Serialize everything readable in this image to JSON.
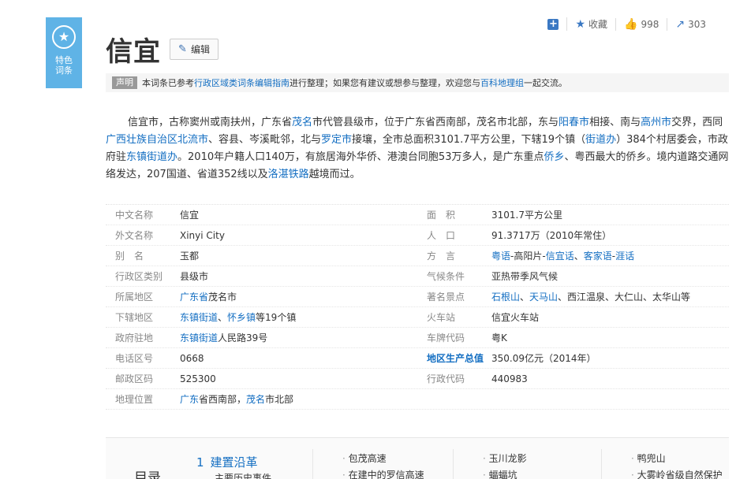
{
  "badge": {
    "line1": "特色",
    "line2": "词条"
  },
  "title": "信宜",
  "edit_label": "编辑",
  "toolbar": {
    "favorite_label": "收藏",
    "likes": "998",
    "shares": "303"
  },
  "notice": {
    "tag": "声明",
    "p1": "本词条已参考",
    "link1": "行政区域类词条编辑指南",
    "p2": "进行整理；如果您有建议或想参与整理，欢迎您与",
    "link2": "百科地理组",
    "p3": "一起交流。"
  },
  "summary": {
    "s1": "信宜市，古称窦州或南扶州，广东省",
    "l1": "茂名",
    "s2": "市代管县级市，位于广东省西南部，茂名市北部，东与",
    "l2": "阳春市",
    "s3": "相接、南与",
    "l3": "高州市",
    "s4": "交界，西同",
    "l4": "广西壮族自治区北流市",
    "s5": "、容县、岑溪毗邻，北与",
    "l5": "罗定市",
    "s6": "接壤，全市总面积3101.7平方公里，下辖19个镇（",
    "l6": "街道办",
    "s7": "）384个村居委会，市政府驻",
    "l7": "东镇街道办",
    "s8": "。2010年户籍人口140万，有旅居海外华侨、港澳台同胞53万多人，是广东重点",
    "l8": "侨乡",
    "s9": "、粤西最大的侨乡。境内道路交通网络发达，207国道、省道352线以及",
    "l9": "洛湛铁路",
    "s10": "越境而过。"
  },
  "info": {
    "r1": {
      "k1": "中文名称",
      "v1": "信宜",
      "k2": "面　积",
      "v2": "3101.7平方公里"
    },
    "r2": {
      "k1": "外文名称",
      "v1": "Xinyi City",
      "k2": "人　口",
      "v2": "91.3717万（2010年常住）"
    },
    "r3": {
      "k1": "别　名",
      "v1": "玉都",
      "k2": "方　言",
      "v2a": "粤语",
      "v2b": "-高阳片-",
      "v2c": "信宜话",
      "v2d": "、",
      "v2e": "客家语",
      "v2f": "-",
      "v2g": "涯话"
    },
    "r4": {
      "k1": "行政区类别",
      "v1": "县级市",
      "k2": "气候条件",
      "v2": "亚热带季风气候"
    },
    "r5": {
      "k1": "所属地区",
      "v1a": "广东省",
      "v1b": "茂名市",
      "k2": "著名景点",
      "v2a": "石根山",
      "v2b": "、",
      "v2c": "天马山",
      "v2d": "、西江温泉、大仁山、太华山等"
    },
    "r6": {
      "k1": "下辖地区",
      "v1a": "东镇街道",
      "v1b": "、",
      "v1c": "怀乡镇",
      "v1d": "等19个镇",
      "k2": "火车站",
      "v2": "信宜火车站"
    },
    "r7": {
      "k1": "政府驻地",
      "v1a": "东镇街道",
      "v1b": "人民路39号",
      "k2": "车牌代码",
      "v2": "粤K"
    },
    "r8": {
      "k1": "电话区号",
      "v1": "0668",
      "k2": "地区生产总值",
      "v2": "350.09亿元（2014年）"
    },
    "r9": {
      "k1": "邮政区码",
      "v1": "525300",
      "k2": "行政代码",
      "v2": "440983"
    },
    "r10": {
      "k1": "地理位置",
      "v1a": "广东",
      "v1b": "省西南部，",
      "v1c": "茂名",
      "v1d": "市北部"
    }
  },
  "toc": {
    "head": "目录",
    "n1": "1",
    "t1": "建置沿革",
    "sub1": "主要历史事件",
    "col1": [
      "包茂高速",
      "在建中的罗信高速"
    ],
    "col2": [
      "玉川龙影",
      "蝠蝠坑"
    ],
    "col3": [
      "鸭兜山",
      "大雾岭省级自然保护"
    ]
  }
}
